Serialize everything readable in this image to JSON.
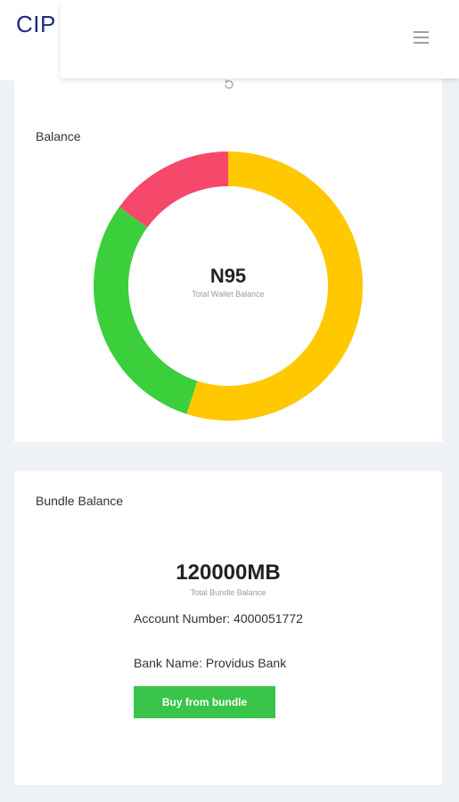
{
  "app": {
    "brand": "CIP"
  },
  "header": {
    "menu_icon": "hamburger-menu-icon"
  },
  "balance_card": {
    "title": "Balance",
    "refresh_icon": "refresh-icon",
    "total_value": "N95",
    "total_caption": "Total Wallet Balance"
  },
  "chart_data": {
    "type": "pie",
    "series": [
      {
        "value": 55,
        "color": "#ffc800"
      },
      {
        "value": 30,
        "color": "#3ccf3c"
      },
      {
        "value": 15,
        "color": "#f5486a"
      }
    ]
  },
  "bundle_card": {
    "title": "Bundle Balance",
    "total_value": "120000MB",
    "total_caption": "Total Bundle Balance",
    "account_number": "Account Number: 4000051772",
    "bank_name": "Bank Name: Providus Bank",
    "buy_button": "Buy from bundle"
  }
}
